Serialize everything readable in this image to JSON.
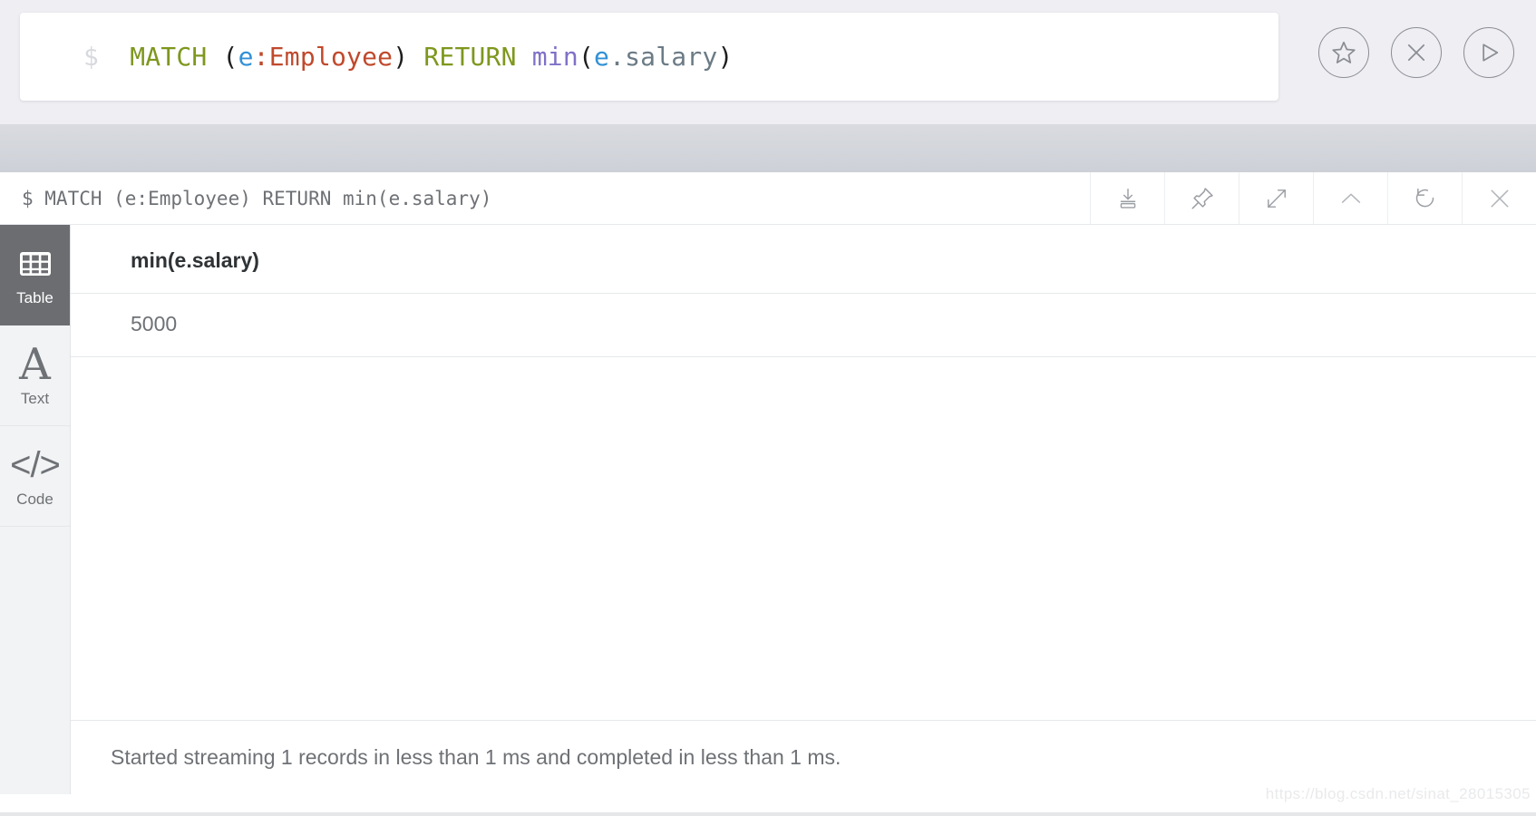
{
  "editor": {
    "prompt": "$",
    "query_tokens": [
      {
        "text": "MATCH",
        "type": "keyword"
      },
      {
        "text": " ",
        "type": "plain"
      },
      {
        "text": "(",
        "type": "paren"
      },
      {
        "text": "e",
        "type": "var"
      },
      {
        "text": ":",
        "type": "colon"
      },
      {
        "text": "Employee",
        "type": "label"
      },
      {
        "text": ")",
        "type": "paren"
      },
      {
        "text": " ",
        "type": "plain"
      },
      {
        "text": "RETURN",
        "type": "keyword"
      },
      {
        "text": " ",
        "type": "plain"
      },
      {
        "text": "min",
        "type": "func"
      },
      {
        "text": "(",
        "type": "paren"
      },
      {
        "text": "e",
        "type": "var"
      },
      {
        "text": ".salary",
        "type": "prop"
      },
      {
        "text": ")",
        "type": "paren"
      }
    ],
    "query_plain": "MATCH (e:Employee) RETURN min(e.salary)",
    "actions": [
      {
        "name": "favorite-button",
        "icon": "star-icon",
        "label": "Favorite"
      },
      {
        "name": "clear-button",
        "icon": "close-circle-icon",
        "label": "Clear"
      },
      {
        "name": "run-button",
        "icon": "play-icon",
        "label": "Run"
      }
    ]
  },
  "frame": {
    "title": "$ MATCH (e:Employee) RETURN min(e.salary)",
    "tools": [
      {
        "name": "download-button",
        "icon": "download-icon",
        "label": "Download"
      },
      {
        "name": "pin-button",
        "icon": "pin-icon",
        "label": "Pin"
      },
      {
        "name": "expand-button",
        "icon": "expand-icon",
        "label": "Fullscreen"
      },
      {
        "name": "collapse-button",
        "icon": "chevron-up-icon",
        "label": "Collapse"
      },
      {
        "name": "refresh-button",
        "icon": "refresh-icon",
        "label": "Rerun"
      },
      {
        "name": "close-button",
        "icon": "close-icon",
        "label": "Close"
      }
    ]
  },
  "sidebar": {
    "items": [
      {
        "label": "Table",
        "icon": "table-icon",
        "active": true
      },
      {
        "label": "Text",
        "icon": "text-icon",
        "active": false
      },
      {
        "label": "Code",
        "icon": "code-icon",
        "active": false
      }
    ]
  },
  "result": {
    "columns": [
      "min(e.salary)"
    ],
    "rows": [
      [
        "5000"
      ]
    ]
  },
  "status": {
    "message": "Started streaming 1 records in less than 1 ms and completed in less than 1 ms."
  },
  "watermark": {
    "text": "https://blog.csdn.net/sinat_28015305"
  },
  "colors": {
    "keyword": "#7e971e",
    "variable": "#3291d6",
    "label": "#c0492c",
    "function": "#8070c8",
    "property": "#6b7b86",
    "sidebar_active_bg": "#6b6d71",
    "page_bg": "#eeeef3",
    "band_bg": "#d1d4da"
  }
}
